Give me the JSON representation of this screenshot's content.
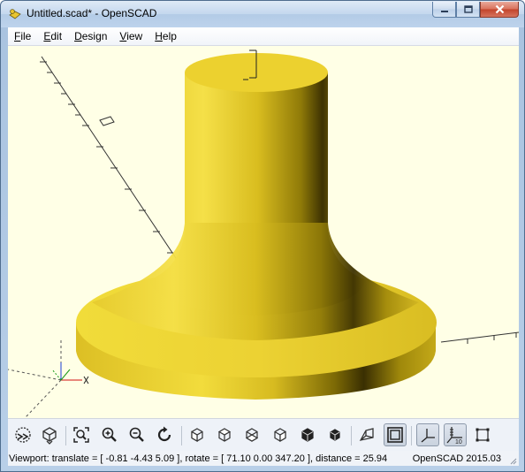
{
  "window": {
    "title": "Untitled.scad* - OpenSCAD",
    "controls": {
      "minimize_icon": "minimize-icon",
      "maximize_icon": "maximize-icon",
      "close_icon": "close-icon"
    }
  },
  "menubar": {
    "items": [
      {
        "first": "F",
        "rest": "ile"
      },
      {
        "first": "E",
        "rest": "dit"
      },
      {
        "first": "D",
        "rest": "esign"
      },
      {
        "first": "V",
        "rest": "iew"
      },
      {
        "first": "H",
        "rest": "elp"
      }
    ]
  },
  "viewport": {
    "background": "#ffffe6",
    "model_color": "#f0d93a",
    "axis_scale_label": "10"
  },
  "toolbar": {
    "buttons": [
      {
        "name": "preview-button",
        "icon": "preview-icon"
      },
      {
        "name": "render-button",
        "icon": "render-icon"
      },
      {
        "name": "view-all-button",
        "icon": "zoom-all-icon"
      },
      {
        "name": "zoom-in-button",
        "icon": "zoom-in-icon"
      },
      {
        "name": "zoom-out-button",
        "icon": "zoom-out-icon"
      },
      {
        "name": "reset-view-button",
        "icon": "reset-view-icon"
      },
      {
        "name": "view-right-button",
        "icon": "view-right-icon"
      },
      {
        "name": "view-top-button",
        "icon": "view-top-icon"
      },
      {
        "name": "view-bottom-button",
        "icon": "view-bottom-icon"
      },
      {
        "name": "view-left-button",
        "icon": "view-left-icon"
      },
      {
        "name": "view-front-button",
        "icon": "view-front-icon"
      },
      {
        "name": "view-back-button",
        "icon": "view-back-icon"
      },
      {
        "name": "perspective-button",
        "icon": "perspective-icon"
      },
      {
        "name": "orthogonal-button",
        "icon": "orthogonal-icon",
        "pressed": true
      },
      {
        "name": "show-axes-button",
        "icon": "axes-icon",
        "pressed": true
      },
      {
        "name": "show-scale-markers-button",
        "icon": "scale-markers-icon",
        "pressed": true
      },
      {
        "name": "show-edges-button",
        "icon": "edges-icon"
      }
    ]
  },
  "statusbar": {
    "viewport_info": "Viewport: translate = [ -0.81 -4.43 5.09 ], rotate = [ 71.10 0.00 347.20 ], distance = 25.94",
    "version": "OpenSCAD 2015.03"
  }
}
